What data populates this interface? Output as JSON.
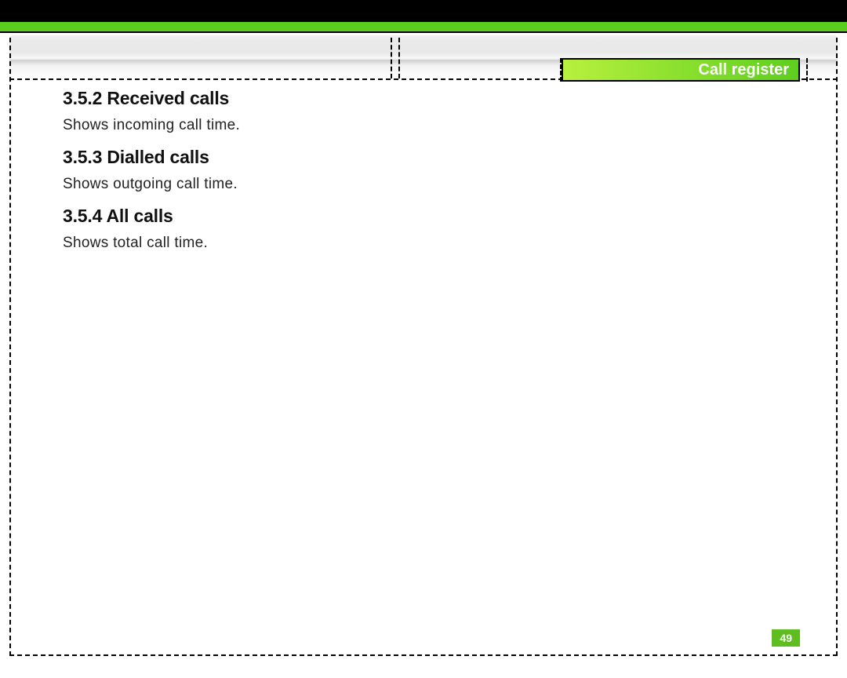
{
  "header": {
    "section_tab": "Call register"
  },
  "sections": {
    "s1": {
      "heading": "3.5.2 Received calls",
      "body": "Shows incoming call time."
    },
    "s2": {
      "heading": "3.5.3 Dialled calls",
      "body": "Shows outgoing call time."
    },
    "s3": {
      "heading": "3.5.4 All calls",
      "body": "Shows total call time."
    }
  },
  "page_number": "49"
}
